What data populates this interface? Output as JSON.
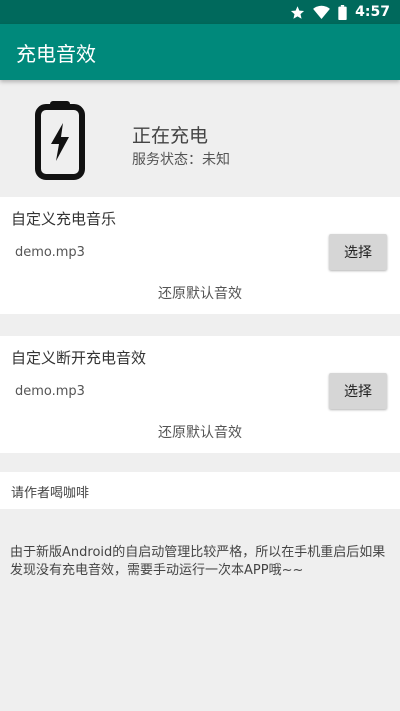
{
  "status_bar": {
    "time": "4:57",
    "icons": [
      "star-icon",
      "wifi-icon",
      "battery-status-icon"
    ]
  },
  "app_bar": {
    "title": "充电音效"
  },
  "charging": {
    "icon": "charging-battery-icon",
    "status": "正在充电",
    "service_status": "服务状态：未知"
  },
  "custom_music": {
    "title": "自定义充电音乐",
    "file": "demo.mp3",
    "choose_label": "选择",
    "restore_label": "还原默认音效"
  },
  "custom_disconnect": {
    "title": "自定义断开充电音效",
    "file": "demo.mp3",
    "choose_label": "选择",
    "restore_label": "还原默认音效"
  },
  "coffee": {
    "label": "请作者喝咖啡"
  },
  "notice": {
    "text": "由于新版Android的自启动管理比较严格，所以在手机重启后如果发现没有充电音效，需要手动运行一次本APP哦~~"
  },
  "colors": {
    "primary": "#00897b",
    "primary_dark": "#00695c",
    "background": "#efefef"
  }
}
